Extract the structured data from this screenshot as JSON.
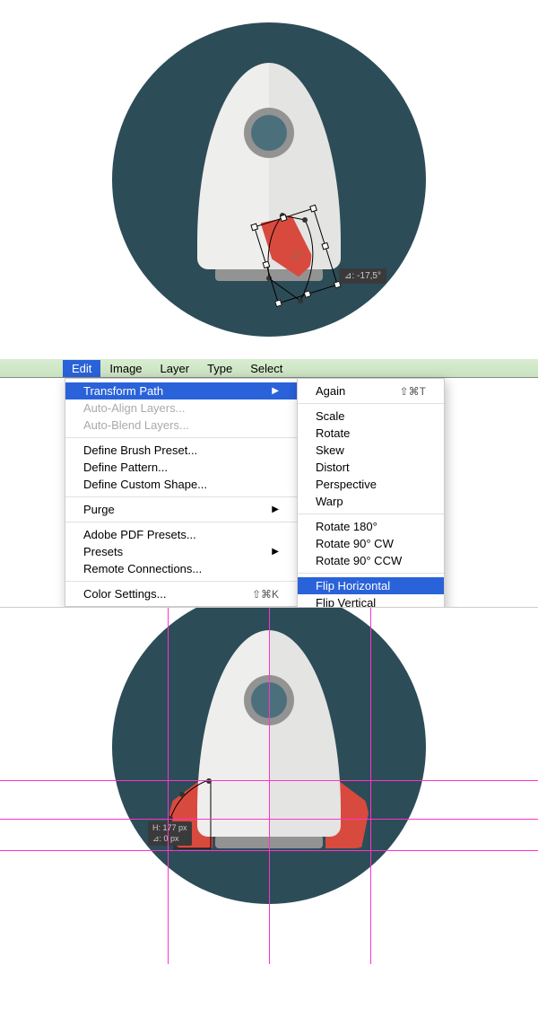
{
  "canvas1": {
    "angle_tooltip": "-17,5°",
    "angle_tooltip_label": "⊿:"
  },
  "menubar": {
    "items": [
      "Edit",
      "Image",
      "Layer",
      "Type",
      "Select"
    ],
    "active_index": 0
  },
  "edit_menu": {
    "transform_path": "Transform Path",
    "auto_align": "Auto-Align Layers...",
    "auto_blend": "Auto-Blend Layers...",
    "define_brush": "Define Brush Preset...",
    "define_pattern": "Define Pattern...",
    "define_shape": "Define Custom Shape...",
    "purge": "Purge",
    "pdf_presets": "Adobe PDF Presets...",
    "presets": "Presets",
    "remote": "Remote Connections...",
    "color_settings": "Color Settings...",
    "color_settings_shortcut": "⇧⌘K"
  },
  "transform_submenu": {
    "again": "Again",
    "again_shortcut": "⇧⌘T",
    "scale": "Scale",
    "rotate": "Rotate",
    "skew": "Skew",
    "distort": "Distort",
    "perspective": "Perspective",
    "warp": "Warp",
    "rotate180": "Rotate 180°",
    "rotate90cw": "Rotate 90° CW",
    "rotate90ccw": "Rotate 90° CCW",
    "flip_h": "Flip Horizontal",
    "flip_v": "Flip Vertical"
  },
  "canvas2": {
    "measure_h": "H: 177 px",
    "measure_v": "⊿: 0 px"
  }
}
